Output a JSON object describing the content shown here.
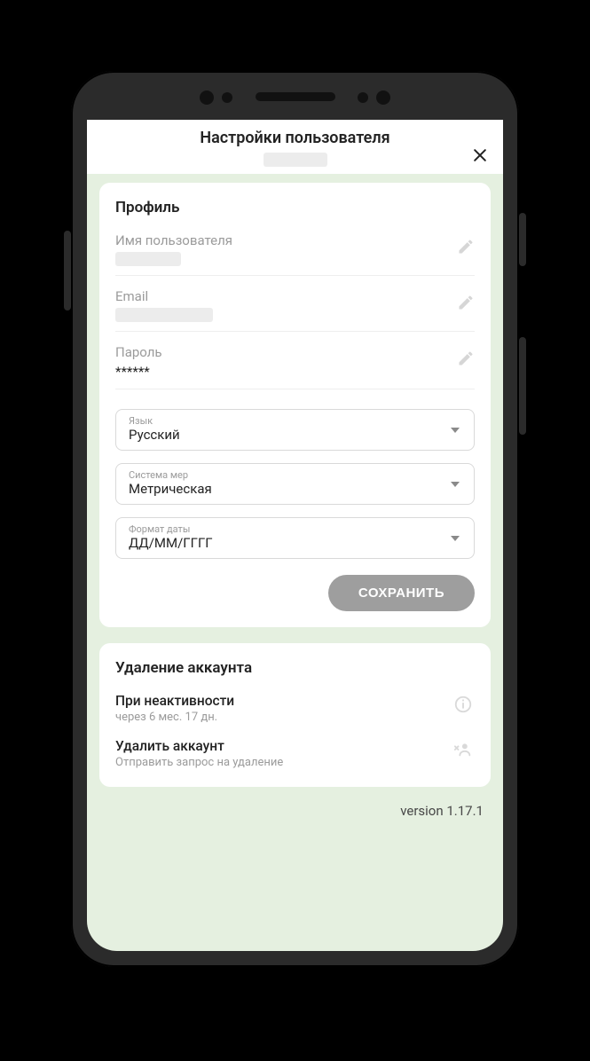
{
  "header": {
    "title": "Настройки пользователя"
  },
  "profile": {
    "title": "Профиль",
    "username_label": "Имя пользователя",
    "email_label": "Email",
    "password_label": "Пароль",
    "password_value": "******",
    "language_label": "Язык",
    "language_value": "Русский",
    "units_label": "Система мер",
    "units_value": "Метрическая",
    "dateformat_label": "Формат даты",
    "dateformat_value": "ДД/ММ/ГГГГ",
    "save_label": "СОХРАНИТЬ"
  },
  "delete": {
    "title": "Удаление аккаунта",
    "inactivity_title": "При неактивности",
    "inactivity_sub": "через 6 мес. 17 дн.",
    "delete_title": "Удалить аккаунт",
    "delete_sub": "Отправить запрос на удаление"
  },
  "footer": {
    "version": "version 1.17.1"
  }
}
